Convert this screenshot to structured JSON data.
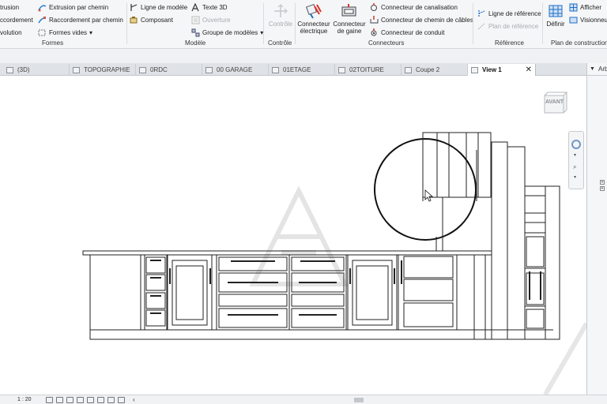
{
  "ribbon": {
    "formes": {
      "items": [
        "trusion",
        "ccordement",
        "volution",
        "Extrusion par chemin",
        "Raccordement par chemin",
        "Formes vides"
      ],
      "label": "Formes"
    },
    "modele": {
      "items": [
        "Ligne de modèle",
        "Composant",
        "Texte 3D",
        "Ouverture",
        "Groupe de modèles"
      ],
      "label": "Modèle"
    },
    "controle": {
      "button": "Contrôle",
      "label": "Contrôle"
    },
    "connecteurs": {
      "electrique": "Connecteur électrique",
      "gaine": "Connecteur de gaine",
      "canalisation": "Connecteur de canalisation",
      "chemin_cables": "Connecteur de chemin de câbles",
      "conduit": "Connecteur de conduit",
      "label": "Connecteurs"
    },
    "reference": {
      "ligne": "Ligne de référence",
      "plan": "Plan de référence",
      "label": "Référence"
    },
    "construction": {
      "definir": "Définir",
      "afficher": "Afficher",
      "visionneuse": "Visionneu",
      "label": "Plan de construction"
    }
  },
  "tabs": [
    {
      "label": "(3D)",
      "active": false
    },
    {
      "label": "TOPOGRAPHIE",
      "active": false
    },
    {
      "label": "0RDC",
      "active": false
    },
    {
      "label": "00 GARAGE",
      "active": false
    },
    {
      "label": "01ETAGE",
      "active": false
    },
    {
      "label": "02TOITURE",
      "active": false
    },
    {
      "label": "Coupe 2",
      "active": false
    },
    {
      "label": "View 1",
      "active": true
    }
  ],
  "viewcube": {
    "face": "AVANT"
  },
  "right_panel": {
    "title": "Arb"
  },
  "status": {
    "scale": "1 : 20"
  },
  "colors": {
    "ribbon_bg": "#f5f6f7",
    "tab_active": "#ffffff",
    "accent_red": "#d9342b",
    "accent_blue": "#1f6fc5"
  }
}
